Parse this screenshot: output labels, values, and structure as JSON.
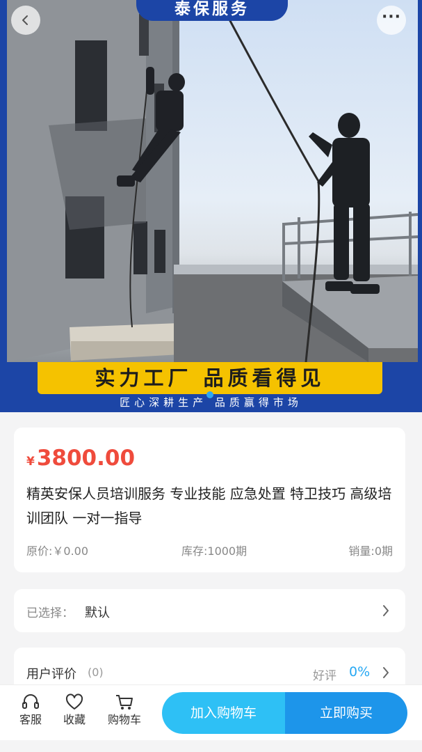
{
  "banner": {
    "brand": "泰保服务",
    "slogan": "实力工厂 品质看得见",
    "sub_slogan": "匠心深耕生产 品质赢得市场",
    "page_indicator_count": 1
  },
  "header": {
    "back_icon": "chevron-left-icon",
    "more_icon": "more-dots-icon",
    "more_glyph": "···"
  },
  "product": {
    "currency": "¥",
    "price": "3800.00",
    "title": "精英安保人员培训服务 专业技能 应急处置 特卫技巧 高级培训团队 一对一指导",
    "original_price": "原价:￥0.00",
    "stock": "库存:1000期",
    "sales": "销量:0期"
  },
  "selection": {
    "label": "已选择：",
    "value": "默认"
  },
  "reviews": {
    "label": "用户评价",
    "count": "(0)",
    "good_label": "好评",
    "good_rate": "0%"
  },
  "bottom_bar": {
    "service_label": "客服",
    "favorite_label": "收藏",
    "cart_label": "购物车",
    "add_to_cart": "加入购物车",
    "buy_now": "立即购买"
  },
  "colors": {
    "price": "#ef4b3c",
    "accent": "#27a8f3",
    "cart_button": "#2ec0f5",
    "buy_button": "#1d95ea",
    "banner_blue": "#1c45a6",
    "banner_yellow": "#f5c200"
  }
}
